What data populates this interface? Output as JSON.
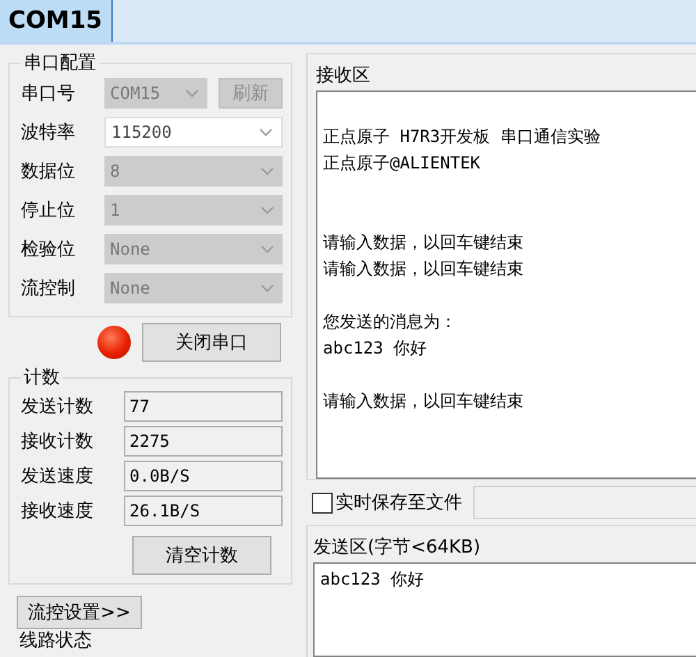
{
  "window": {
    "tab": "COM15"
  },
  "port_config": {
    "title": "串口配置",
    "fields": [
      {
        "label": "串口号",
        "value": "COM15",
        "disabled": true
      },
      {
        "label": "波特率",
        "value": "115200",
        "disabled": false
      },
      {
        "label": "数据位",
        "value": "8",
        "disabled": true
      },
      {
        "label": "停止位",
        "value": "1",
        "disabled": true
      },
      {
        "label": "检验位",
        "value": "None",
        "disabled": true
      },
      {
        "label": "流控制",
        "value": "None",
        "disabled": true
      }
    ],
    "refresh_button": {
      "label": "刷新",
      "disabled": true
    }
  },
  "port_status": {
    "on": true,
    "button": "关闭串口"
  },
  "counts": {
    "title": "计数",
    "rows": [
      {
        "label": "发送计数",
        "value": "77"
      },
      {
        "label": "接收计数",
        "value": "2275"
      },
      {
        "label": "发送速度",
        "value": "0.0B/S"
      },
      {
        "label": "接收速度",
        "value": "26.1B/S"
      }
    ],
    "clear_button": "清空计数"
  },
  "flow_settings_button": "流控设置>>",
  "line_status_title": "线路状态",
  "receive": {
    "title": "接收区",
    "paragraphs": [
      {
        "kind": "banner",
        "lines": [
          "正点原子 H7R3开发板 串口通信实验",
          "正点原子@ALIENTEK"
        ]
      },
      {
        "kind": "message",
        "lines": [
          "请输入数据，以回车键结束",
          "请输入数据，以回车键结束"
        ]
      },
      {
        "kind": "message",
        "lines": [
          "您发送的消息为：",
          "abc123 你好"
        ]
      },
      {
        "kind": "message",
        "lines": [
          "请输入数据，以回车键结束"
        ]
      }
    ]
  },
  "save_to_file": {
    "label": "实时保存至文件",
    "checked": false
  },
  "send": {
    "title": "发送区(字节<64KB)",
    "value": "abc123 你好"
  }
}
